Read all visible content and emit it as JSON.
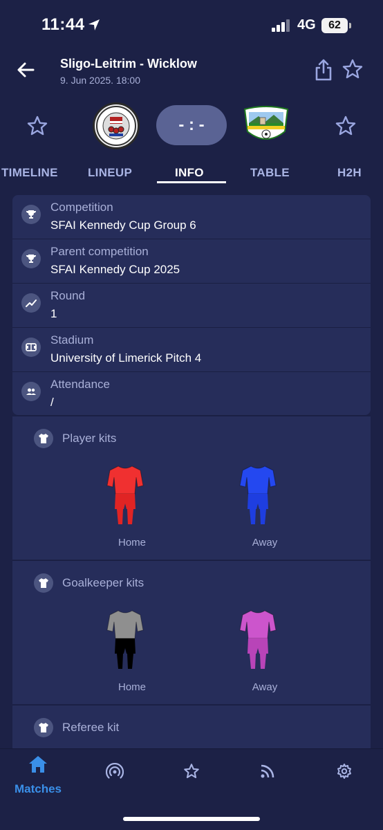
{
  "status_bar": {
    "time": "11:44",
    "network": "4G",
    "battery": "62"
  },
  "header": {
    "title": "Sligo-Leitrim - Wicklow",
    "subtitle": "9. Jun 2025. 18:00"
  },
  "match": {
    "score": "- : -"
  },
  "tabs": [
    {
      "label": "TIMELINE",
      "active": false
    },
    {
      "label": "LINEUP",
      "active": false
    },
    {
      "label": "INFO",
      "active": true
    },
    {
      "label": "TABLE",
      "active": false
    },
    {
      "label": "H2H",
      "active": false
    }
  ],
  "info": [
    {
      "icon": "trophy-icon",
      "label": "Competition",
      "value": "SFAI Kennedy Cup Group 6"
    },
    {
      "icon": "trophy-icon",
      "label": "Parent competition",
      "value": "SFAI Kennedy Cup 2025"
    },
    {
      "icon": "trend-icon",
      "label": "Round",
      "value": "1"
    },
    {
      "icon": "stadium-icon",
      "label": "Stadium",
      "value": "University of Limerick Pitch 4"
    },
    {
      "icon": "people-icon",
      "label": "Attendance",
      "value": "/"
    }
  ],
  "kits": {
    "player": {
      "title": "Player kits",
      "home_label": "Home",
      "away_label": "Away"
    },
    "goalkeeper": {
      "title": "Goalkeeper kits",
      "home_label": "Home",
      "away_label": "Away"
    },
    "referee": {
      "title": "Referee kit"
    }
  },
  "kit_colors": {
    "player_home": {
      "shirt": "#f03030",
      "shorts": "#e02424",
      "socks": "#e02424"
    },
    "player_away": {
      "shirt": "#2448f0",
      "shorts": "#1e3ee0",
      "socks": "#1e3ee0"
    },
    "gk_home": {
      "shirt": "#8f8f8f",
      "shorts": "#000000",
      "socks": "#000000"
    },
    "gk_away": {
      "shirt": "#cc55cc",
      "shorts": "#b844b8",
      "socks": "#b844b8"
    }
  },
  "bottom_nav": [
    {
      "icon": "home-icon",
      "label": "Matches",
      "active": true
    },
    {
      "icon": "live-icon",
      "label": "",
      "active": false
    },
    {
      "icon": "star-icon",
      "label": "",
      "active": false
    },
    {
      "icon": "feed-icon",
      "label": "",
      "active": false
    },
    {
      "icon": "gear-icon",
      "label": "",
      "active": false
    }
  ],
  "colors": {
    "background": "#1c2146",
    "card": "#262d5a",
    "accent": "#3a8fe8"
  }
}
